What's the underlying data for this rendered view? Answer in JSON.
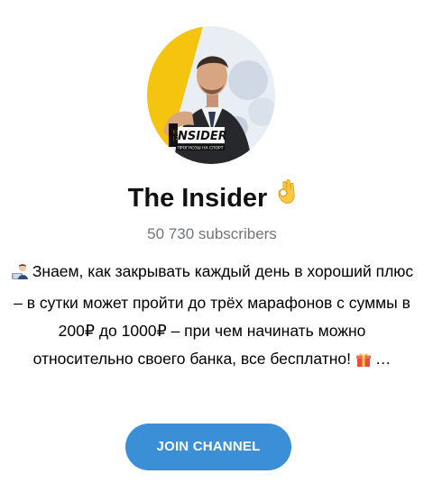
{
  "channel": {
    "name": "The Insider",
    "title_emoji": "ok-hand-emoji",
    "subscribers": "50 730 subscribers",
    "avatar": {
      "brand_text": "THE INSIDER",
      "tagline": "ПРОГНОЗЫ НА СПОРТ"
    }
  },
  "description": {
    "lead_emoji": "man-technologist-emoji",
    "text": "Знаем, как закрывать каждый день в хороший плюс – в сутки может пройти до трёх марафонов с суммы в 200₽ до 1000₽ – при чем начинать можно относительно своего банка, все бесплатно!",
    "trail_emoji": "gift-emoji",
    "ellipsis": "…"
  },
  "actions": {
    "join_label": "JOIN CHANNEL"
  },
  "colors": {
    "accent": "#3a8fd6",
    "muted": "#707579",
    "avatar_yellow": "#f4c40f"
  }
}
